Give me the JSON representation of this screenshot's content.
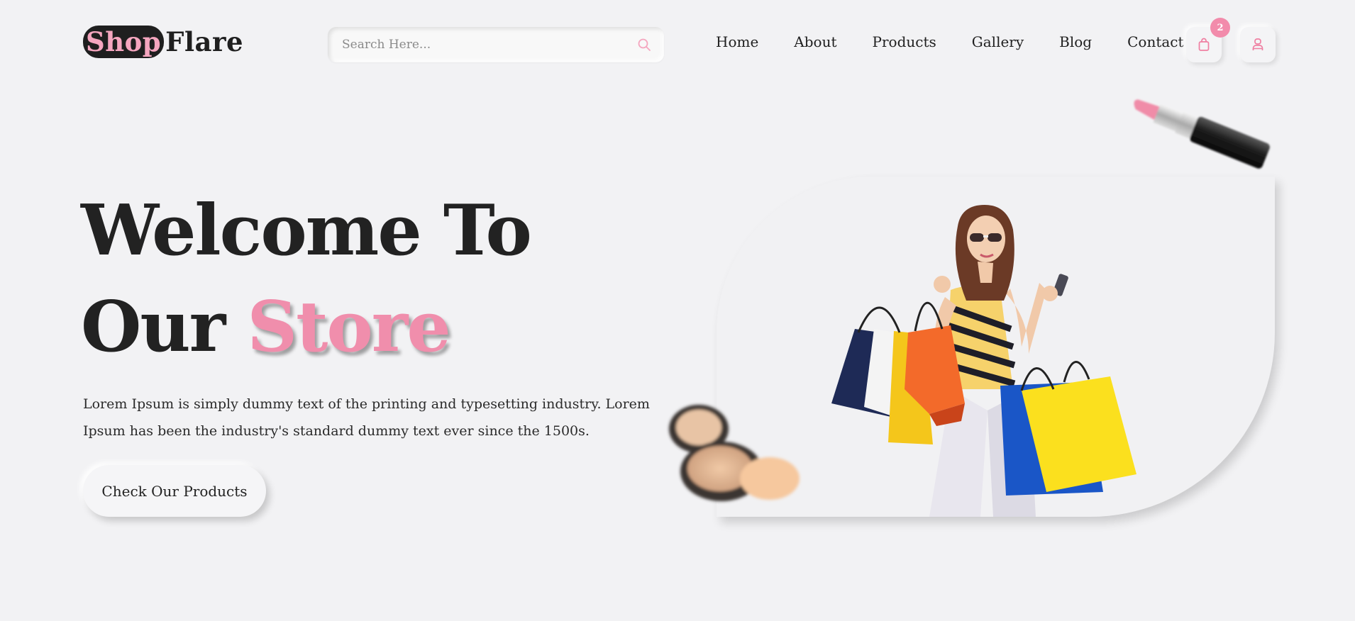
{
  "brand": {
    "part1": "Shop",
    "part2": "Flare",
    "accent_color": "#f28bab",
    "dark_color": "#1f1f1f"
  },
  "search": {
    "placeholder": "Search Here...",
    "icon": "search-icon"
  },
  "nav": {
    "items": [
      {
        "label": "Home"
      },
      {
        "label": "About"
      },
      {
        "label": "Products"
      },
      {
        "label": "Gallery"
      },
      {
        "label": "Blog"
      },
      {
        "label": "Contact"
      }
    ]
  },
  "cart": {
    "icon": "shopping-bag-icon",
    "count": "2"
  },
  "account": {
    "icon": "user-icon"
  },
  "hero": {
    "title_line1": "Welcome To",
    "title_line2_plain": "Our",
    "title_line2_accent": "Store",
    "description": "Lorem Ipsum is simply dummy text of the printing and typesetting industry. Lorem Ipsum has been the industry's standard dummy text ever since the 1500s.",
    "cta_label": "Check Our Products"
  }
}
